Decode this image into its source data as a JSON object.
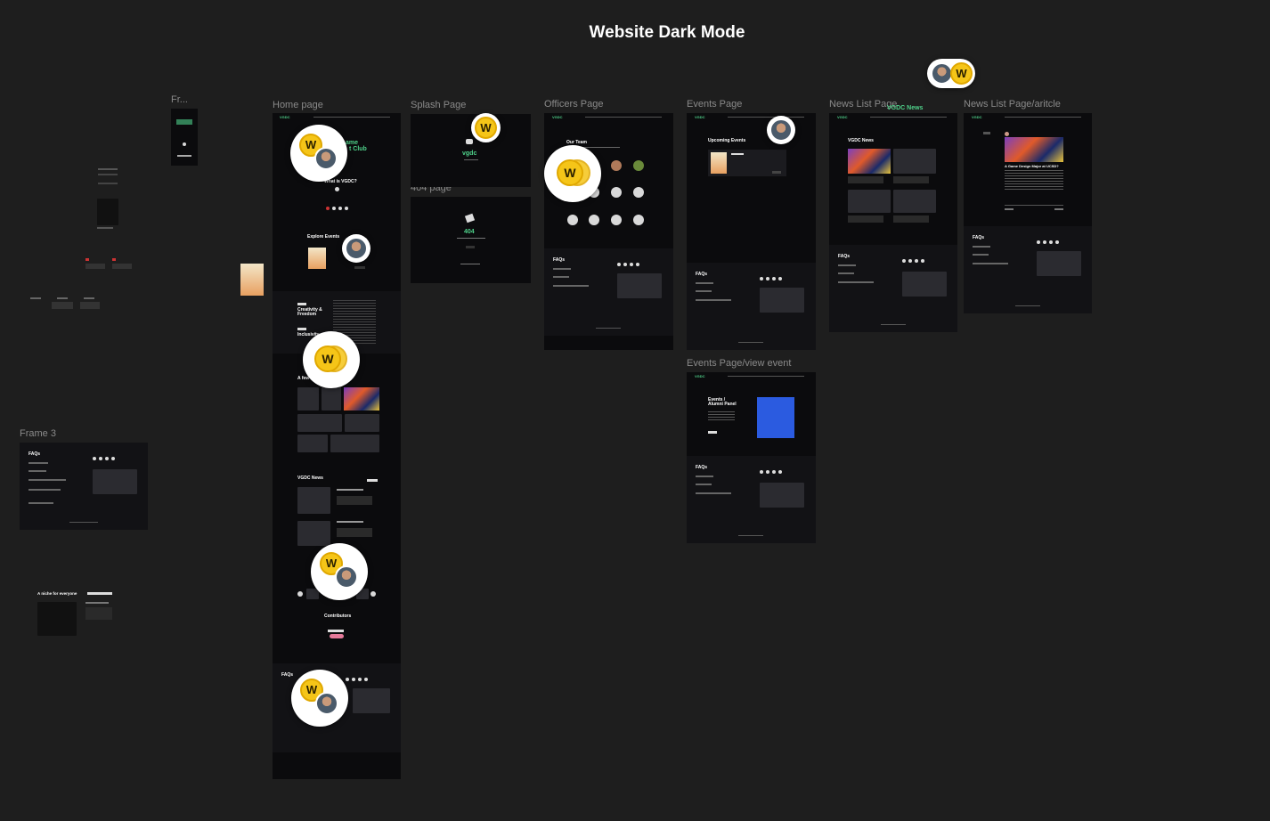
{
  "canvas": {
    "title": "Website Dark Mode",
    "background": "#1e1e1e"
  },
  "frame_labels": {
    "fr": "Fr...",
    "home": "Home page",
    "splash": "Splash Page",
    "page404": "404 page",
    "officers": "Officers Page",
    "events": "Events Page",
    "events_view": "Events Page/view event",
    "news_list": "News List Page",
    "news_article": "News List Page/aritcle",
    "frame3": "Frame 3"
  },
  "home": {
    "logo": "VGDC",
    "hero_line1": "ame",
    "hero_line2": "t Club",
    "what_is": "What is VGDC?",
    "explore_events": "Explore Events",
    "creativity": "Creativity &",
    "freedom": "Freedom",
    "inclusivity": "Inclusivity",
    "few": "A few",
    "news_title": "VGDC News",
    "contributors": "Contributors",
    "faqs": "FAQs"
  },
  "splash": {
    "brand": "vgdc"
  },
  "page404": {
    "code": "404"
  },
  "officers": {
    "our_team": "Our Team",
    "faqs": "FAQs"
  },
  "events": {
    "upcoming": "Upcoming Events",
    "faqs": "FAQs"
  },
  "events_view": {
    "heading_line1": "Events /",
    "heading_line2": "Alumni Panel",
    "faqs": "FAQs"
  },
  "news_list": {
    "floating_title": "VGDC News",
    "title": "VGDC News",
    "faqs": "FAQs"
  },
  "news_article": {
    "headline": "A Game Design Major at UCSD?",
    "faqs": "FAQs"
  },
  "frame3": {
    "faqs": "FAQs"
  },
  "misc": {
    "niche": "A niche for everyone"
  },
  "collaborators": {
    "badge_letter": "W",
    "badge_color": "#f5c518"
  }
}
